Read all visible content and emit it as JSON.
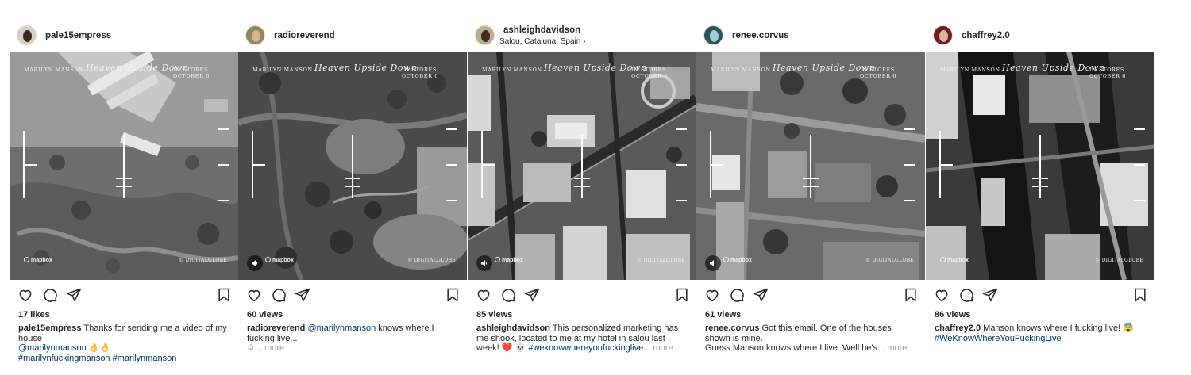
{
  "overlay": {
    "artist": "MARILYN MANSON",
    "title": "Heaven Upside Down",
    "in_stores": "IN STORES OCTOBER 6",
    "map_credit": "mapbox",
    "imagery_credit": "© DIGITALGLOBE"
  },
  "posts": [
    {
      "username": "pale15empress",
      "location": "",
      "stat": "17 likes",
      "caption_user": "pale15empress",
      "caption_text": "Thanks for sending me a video of my house",
      "caption_line2_tag": "@marilynmanson",
      "caption_line2_emoji": "👌👌",
      "caption_line3": "#marilynfuckingmanson #marilynmanson",
      "more": ""
    },
    {
      "username": "radioreverend",
      "location": "",
      "stat": "60 views",
      "caption_user": "radioreverend",
      "caption_tag": "@marilynmanson",
      "caption_text": "knows where I fucking live...",
      "caption_line3": "♤...",
      "more": "more"
    },
    {
      "username": "ashleighdavidson",
      "location": "Salou, Cataluna, Spain",
      "stat": "85 views",
      "caption_user": "ashleighdavidson",
      "caption_text": "This personalized marketing has me shook, located to me at my hotel in salou last week!",
      "caption_emoji": "❤️ 💀",
      "caption_tag": "#weknowwhereyoufuckinglive...",
      "more": "more"
    },
    {
      "username": "renee.corvus",
      "location": "",
      "stat": "61 views",
      "caption_user": "renee.corvus",
      "caption_text": "Got this email.  One of the houses shown is mine.",
      "caption_line3": "Guess Manson knows where I live.  Well he's...",
      "more": "more"
    },
    {
      "username": "chaffrey2.0",
      "location": "",
      "stat": "86 views",
      "caption_user": "chaffrey2.0",
      "caption_text": "Manson knows where I fucking live!",
      "caption_emoji": "😨",
      "caption_tag": "#WeKnowWhereYouFuckingLive",
      "more": ""
    }
  ],
  "colors": {
    "text": "#262626",
    "link": "#003569",
    "muted": "#999999",
    "heart": "#ed4956"
  },
  "icons": [
    "heart-icon",
    "comment-icon",
    "share-icon",
    "bookmark-icon",
    "chevron-right-icon",
    "speaker-icon"
  ]
}
